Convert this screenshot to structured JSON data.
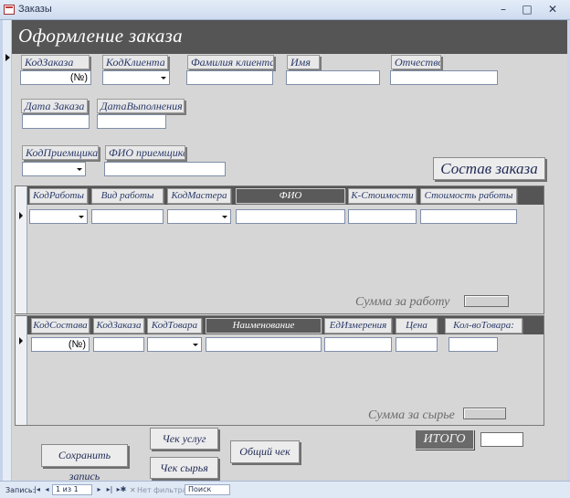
{
  "window": {
    "title": "Заказы",
    "min_glyph": "–",
    "max_glyph": "□",
    "close_glyph": "✕"
  },
  "header": {
    "title": "Оформление заказа"
  },
  "order_fields": {
    "order_id_label": "КодЗаказа",
    "order_id_value": "(№)",
    "client_id_label": "КодКлиента",
    "client_lastname_label": "Фамилия клиента",
    "client_firstname_label": "Имя",
    "client_patronymic_label": "Отчество",
    "order_date_label": "Дата Заказа",
    "completion_date_label": "ДатаВыполнения",
    "receiver_id_label": "КодПриемщика",
    "receiver_name_label": "ФИО приемщика"
  },
  "order_contents_button": "Состав заказа",
  "works_subform": {
    "columns": [
      "КодРаботы",
      "Вид работы",
      "КодМастера",
      "ФИО",
      "К-Стоимости",
      "Стоимость работы"
    ],
    "sum_label": "Сумма за работу"
  },
  "materials_subform": {
    "columns": [
      "КодСостава",
      "КодЗаказа",
      "КодТовара",
      "Наименование",
      "ЕдИзмерения",
      "Цена",
      "Кол-воТовара:"
    ],
    "new_row_code": "(№)",
    "sum_label": "Сумма за сырье"
  },
  "total_label": "ИТОГО",
  "buttons": {
    "save_record": "Сохранить запись",
    "services_receipt": "Чек услуг",
    "materials_receipt": "Чек сырья",
    "total_receipt": "Общий чек"
  },
  "statusbar": {
    "record_label": "Запись:",
    "first": "|◂",
    "prev": "◂",
    "position": "1 из 1",
    "next": "▸",
    "last": "▸|",
    "new": "▸✱",
    "filter_icon_glyph": "✕",
    "filter_text": "Нет фильтра",
    "search_text": "Поиск"
  }
}
